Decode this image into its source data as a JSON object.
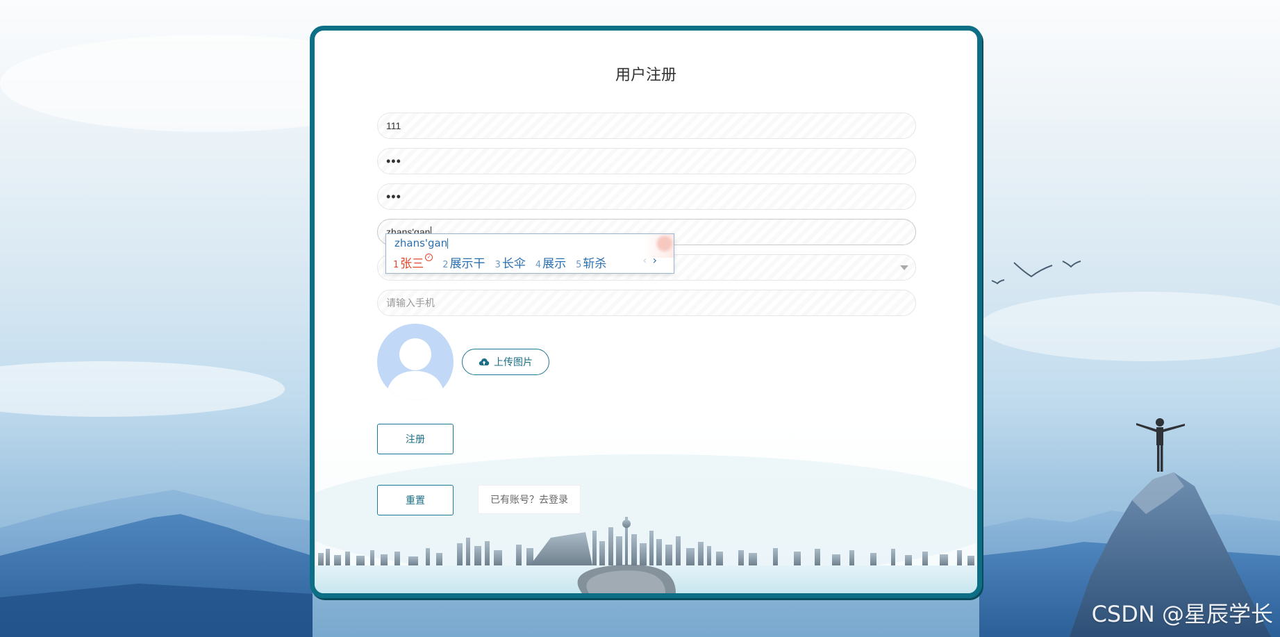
{
  "page": {
    "title": "用户注册",
    "watermark": "CSDN @星辰学长"
  },
  "form": {
    "username_value": "111",
    "password_value": "•••",
    "confirm_password_value": "•••",
    "name_value": "zhans'gan",
    "select_value": "",
    "phone_placeholder": "请输入手机",
    "upload_label": "上传图片",
    "register_label": "注册",
    "reset_label": "重置",
    "login_link_label": "已有账号？去登录"
  },
  "ime": {
    "composition": "zhans'gan",
    "candidates": [
      {
        "num": "1",
        "text": "张三",
        "selected": true
      },
      {
        "num": "2",
        "text": "展示干",
        "selected": false
      },
      {
        "num": "3",
        "text": "长伞",
        "selected": false
      },
      {
        "num": "4",
        "text": "展示",
        "selected": false
      },
      {
        "num": "5",
        "text": "斩杀",
        "selected": false
      }
    ],
    "prev": "‹",
    "next": "›"
  },
  "colors": {
    "accent": "#0d6f86",
    "ime_highlight": "#e0462a",
    "ime_text": "#2a6fb0",
    "avatar_bg": "#c1d8f7"
  },
  "icons": {
    "upload": "cloud-upload-icon",
    "avatar": "user-avatar-icon"
  }
}
